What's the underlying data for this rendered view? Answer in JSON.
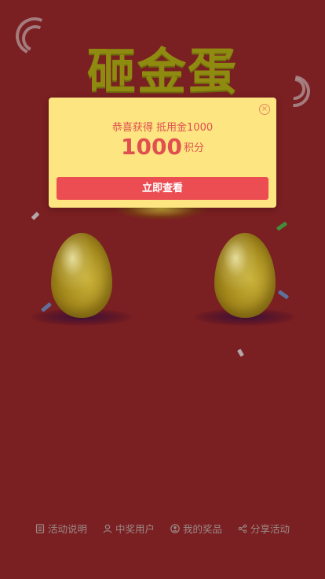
{
  "page": {
    "title": "砸金蛋"
  },
  "modal": {
    "message": "恭喜获得 抵用金1000",
    "points_value": "1000",
    "points_unit": "积分",
    "button_label": "立即查看",
    "close_icon": "close-icon"
  },
  "footer": {
    "items": [
      {
        "label": "活动说明",
        "icon": "document-icon"
      },
      {
        "label": "中奖用户",
        "icon": "user-icon"
      },
      {
        "label": "我的奖品",
        "icon": "account-circle-icon"
      },
      {
        "label": "分享活动",
        "icon": "share-icon"
      }
    ]
  },
  "colors": {
    "background": "#7a1f22",
    "title": "#8f8a10",
    "modal_bg": "#fde582",
    "accent": "#ec4d52",
    "text_red": "#e0504f"
  }
}
